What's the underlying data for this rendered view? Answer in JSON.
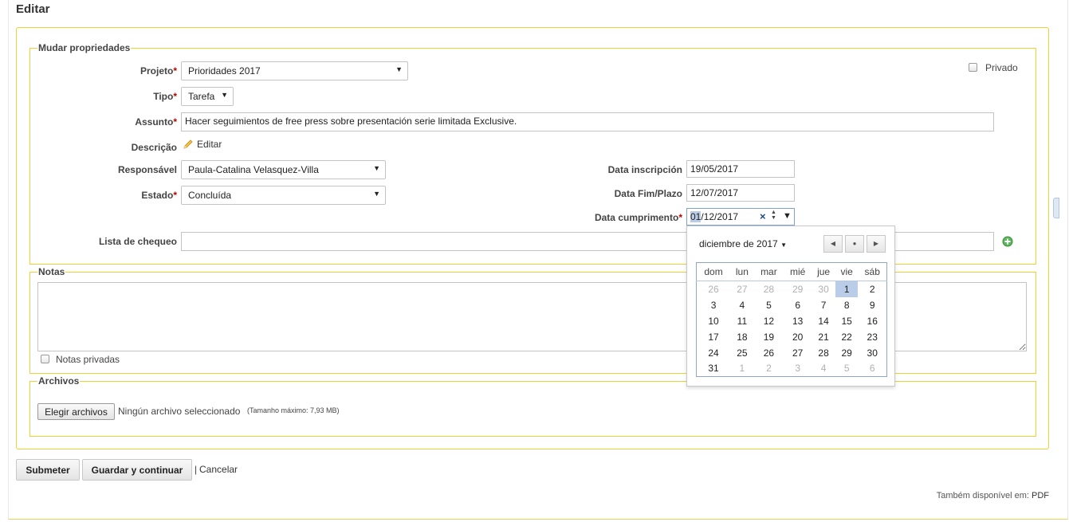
{
  "page": {
    "title": "Editar"
  },
  "properties": {
    "legend": "Mudar propriedades",
    "private_label": "Privado",
    "project": {
      "label": "Projeto",
      "value": "Prioridades 2017"
    },
    "type": {
      "label": "Tipo",
      "value": "Tarefa"
    },
    "subject": {
      "label": "Assunto",
      "value": "Hacer seguimientos de free press sobre presentación serie limitada Exclusive."
    },
    "description": {
      "label": "Descrição",
      "edit_label": "Editar"
    },
    "assignee": {
      "label": "Responsável",
      "value": "Paula-Catalina Velasquez-Villa"
    },
    "status": {
      "label": "Estado",
      "value": "Concluída"
    },
    "start_date": {
      "label": "Data inscripción",
      "value": "19/05/2017"
    },
    "due_date": {
      "label": "Data Fim/Plazo",
      "value": "12/07/2017"
    },
    "done_date": {
      "label": "Data cumprimento",
      "value_highlight": "01",
      "value_rest": "/12/2017"
    },
    "checklist": {
      "label": "Lista de chequeo"
    },
    "required_mark": "*"
  },
  "datepicker": {
    "month_label": "diciembre de 2017",
    "weekdays": [
      "dom",
      "lun",
      "mar",
      "mié",
      "jue",
      "vie",
      "sáb"
    ],
    "selected_day": "1",
    "weeks": [
      [
        {
          "d": "26",
          "o": true
        },
        {
          "d": "27",
          "o": true
        },
        {
          "d": "28",
          "o": true
        },
        {
          "d": "29",
          "o": true
        },
        {
          "d": "30",
          "o": true
        },
        {
          "d": "1",
          "o": false
        },
        {
          "d": "2",
          "o": false
        }
      ],
      [
        {
          "d": "3",
          "o": false
        },
        {
          "d": "4",
          "o": false
        },
        {
          "d": "5",
          "o": false
        },
        {
          "d": "6",
          "o": false
        },
        {
          "d": "7",
          "o": false
        },
        {
          "d": "8",
          "o": false
        },
        {
          "d": "9",
          "o": false
        }
      ],
      [
        {
          "d": "10",
          "o": false
        },
        {
          "d": "11",
          "o": false
        },
        {
          "d": "12",
          "o": false
        },
        {
          "d": "13",
          "o": false
        },
        {
          "d": "14",
          "o": false
        },
        {
          "d": "15",
          "o": false
        },
        {
          "d": "16",
          "o": false
        }
      ],
      [
        {
          "d": "17",
          "o": false
        },
        {
          "d": "18",
          "o": false
        },
        {
          "d": "19",
          "o": false
        },
        {
          "d": "20",
          "o": false
        },
        {
          "d": "21",
          "o": false
        },
        {
          "d": "22",
          "o": false
        },
        {
          "d": "23",
          "o": false
        }
      ],
      [
        {
          "d": "24",
          "o": false
        },
        {
          "d": "25",
          "o": false
        },
        {
          "d": "26",
          "o": false
        },
        {
          "d": "27",
          "o": false
        },
        {
          "d": "28",
          "o": false
        },
        {
          "d": "29",
          "o": false
        },
        {
          "d": "30",
          "o": false
        }
      ],
      [
        {
          "d": "31",
          "o": false
        },
        {
          "d": "1",
          "o": true
        },
        {
          "d": "2",
          "o": true
        },
        {
          "d": "3",
          "o": true
        },
        {
          "d": "4",
          "o": true
        },
        {
          "d": "5",
          "o": true
        },
        {
          "d": "6",
          "o": true
        }
      ]
    ]
  },
  "notes": {
    "legend": "Notas",
    "private_label": "Notas privadas"
  },
  "files": {
    "legend": "Archivos",
    "choose_button": "Elegir archivos",
    "no_file": "Ningún archivo seleccionado",
    "max_size": "(Tamanho máximo: 7,93 MB)"
  },
  "actions": {
    "submit": "Submeter",
    "save_continue": "Guardar y continuar",
    "separator": "|",
    "cancel": "Cancelar"
  },
  "footer": {
    "also_available": "Também disponível em:",
    "pdf": "PDF"
  },
  "colors": {
    "fieldset_border": "#f2cf35",
    "required": "#bb0000",
    "selected_day": "#b9cde8"
  }
}
